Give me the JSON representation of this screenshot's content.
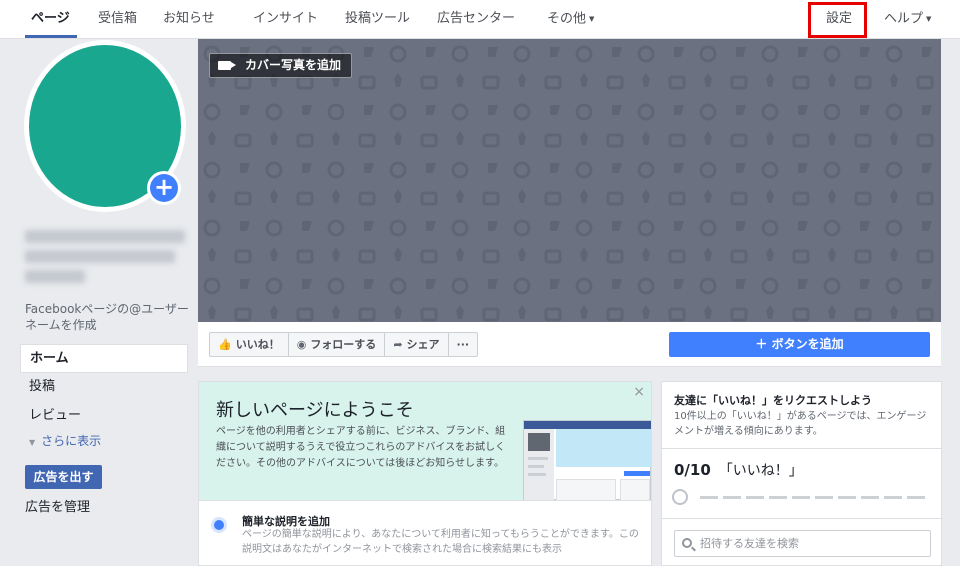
{
  "nav": {
    "items": [
      {
        "label": "ページ",
        "active": true
      },
      {
        "label": "受信箱"
      },
      {
        "label": "お知らせ"
      },
      {
        "label": "インサイト"
      },
      {
        "label": "投稿ツール"
      },
      {
        "label": "広告センター"
      },
      {
        "label": "その他"
      },
      {
        "label": "設定",
        "highlighted": true
      },
      {
        "label": "ヘルプ"
      }
    ],
    "dropdown_caret": "▼"
  },
  "profile": {
    "avatar_color": "#19a78f",
    "add_photo_icon": "plus-icon",
    "username_link": "Facebookページの@ユーザーネームを作成"
  },
  "left_menu": {
    "items": [
      {
        "label": "ホーム",
        "active": true
      },
      {
        "label": "投稿"
      },
      {
        "label": "レビュー"
      }
    ],
    "more_label": "さらに表示",
    "more_arrow": "▼",
    "create_ad_button": "広告を出す",
    "manage_ads": "広告を管理"
  },
  "cover": {
    "add_cover_button": "カバー写真を追加",
    "background_color": "#6b7180"
  },
  "action_bar": {
    "like_icon": "👍",
    "like": "いいね！",
    "follow_icon": "◉",
    "follow": "フォローする",
    "share_icon": "➦",
    "share": "シェア",
    "more": "···",
    "add_button": "＋ ボタンを追加"
  },
  "welcome": {
    "title": "新しいページにようこそ",
    "description": "ページを他の利用者とシェアする前に、ビジネス、ブランド、組織について説明するうえで役立つこれらのアドバイスをお試しください。その他のアドバイスについては後ほどお知らせします。",
    "close": "×",
    "tip": {
      "title": "簡単な説明を追加",
      "description": "ページの簡単な説明により、あなたについて利用者に知ってもらうことができます。この説明文はあなたがインターネットで検索された場合に検索結果にも表示"
    }
  },
  "invite": {
    "title": "友達に「いいね！」をリクエストしよう",
    "description": "10件以上の「いいね！」があるページでは、エンゲージメントが増える傾向にあります。",
    "count": "0/10",
    "count_label": "「いいね！」",
    "progress": 0,
    "search_placeholder": "招待する友達を検索"
  },
  "colors": {
    "brand": "#4267b2",
    "accent": "#4080ff",
    "highlight_border": "#e60000"
  }
}
